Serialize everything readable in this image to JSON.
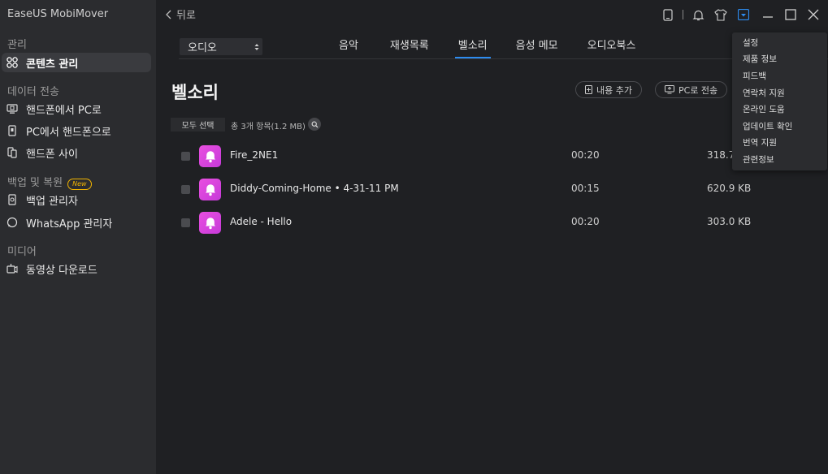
{
  "app": {
    "title": "EaseUS MobiMover"
  },
  "sidebar": {
    "sections": [
      {
        "label": "관리",
        "items": [
          {
            "label": "콘텐츠 관리",
            "icon": "grid-icon",
            "active": true
          }
        ]
      },
      {
        "label": "데이터 전송",
        "items": [
          {
            "label": "핸드폰에서 PC로",
            "icon": "phone-to-pc-icon"
          },
          {
            "label": "PC에서 핸드폰으로",
            "icon": "pc-to-phone-icon"
          },
          {
            "label": "핸드폰 사이",
            "icon": "phone-to-phone-icon"
          }
        ]
      },
      {
        "label": "백업 및 복원",
        "badge": "New",
        "items": [
          {
            "label": "백업 관리자",
            "icon": "backup-icon"
          },
          {
            "label": "WhatsApp 관리자",
            "icon": "whatsapp-icon"
          }
        ]
      },
      {
        "label": "미디어",
        "items": [
          {
            "label": "동영상 다운로드",
            "icon": "video-download-icon"
          }
        ]
      }
    ]
  },
  "header": {
    "back_label": "뒤로"
  },
  "category_select": {
    "value": "오디오"
  },
  "tabs": [
    "음악",
    "재생목록",
    "벨소리",
    "음성 메모",
    "오디오북스"
  ],
  "active_tab": "벨소리",
  "page": {
    "title": "벨소리",
    "add_button": "내용 추가",
    "to_pc_button": "PC로 전송",
    "select_all": "모두 선택",
    "item_count": "총 3개 항목(1.2 MB)"
  },
  "files": [
    {
      "name": "Fire_2NE1",
      "duration": "00:20",
      "size": "318.7"
    },
    {
      "name": "Diddy-Coming-Home • 4-31-11 PM",
      "duration": "00:15",
      "size": "620.9 KB"
    },
    {
      "name": "Adele - Hello",
      "duration": "00:20",
      "size": "303.0 KB"
    }
  ],
  "dropdown_menu": [
    "설정",
    "제품 정보",
    "피드백",
    "연락처 지원",
    "온라인 도움",
    "업데이트 확인",
    "번역 지원",
    "관련정보"
  ],
  "colors": {
    "accent": "#2d8cf0",
    "badge": "#f2b400",
    "ringtone_icon": "#e94fe0"
  }
}
